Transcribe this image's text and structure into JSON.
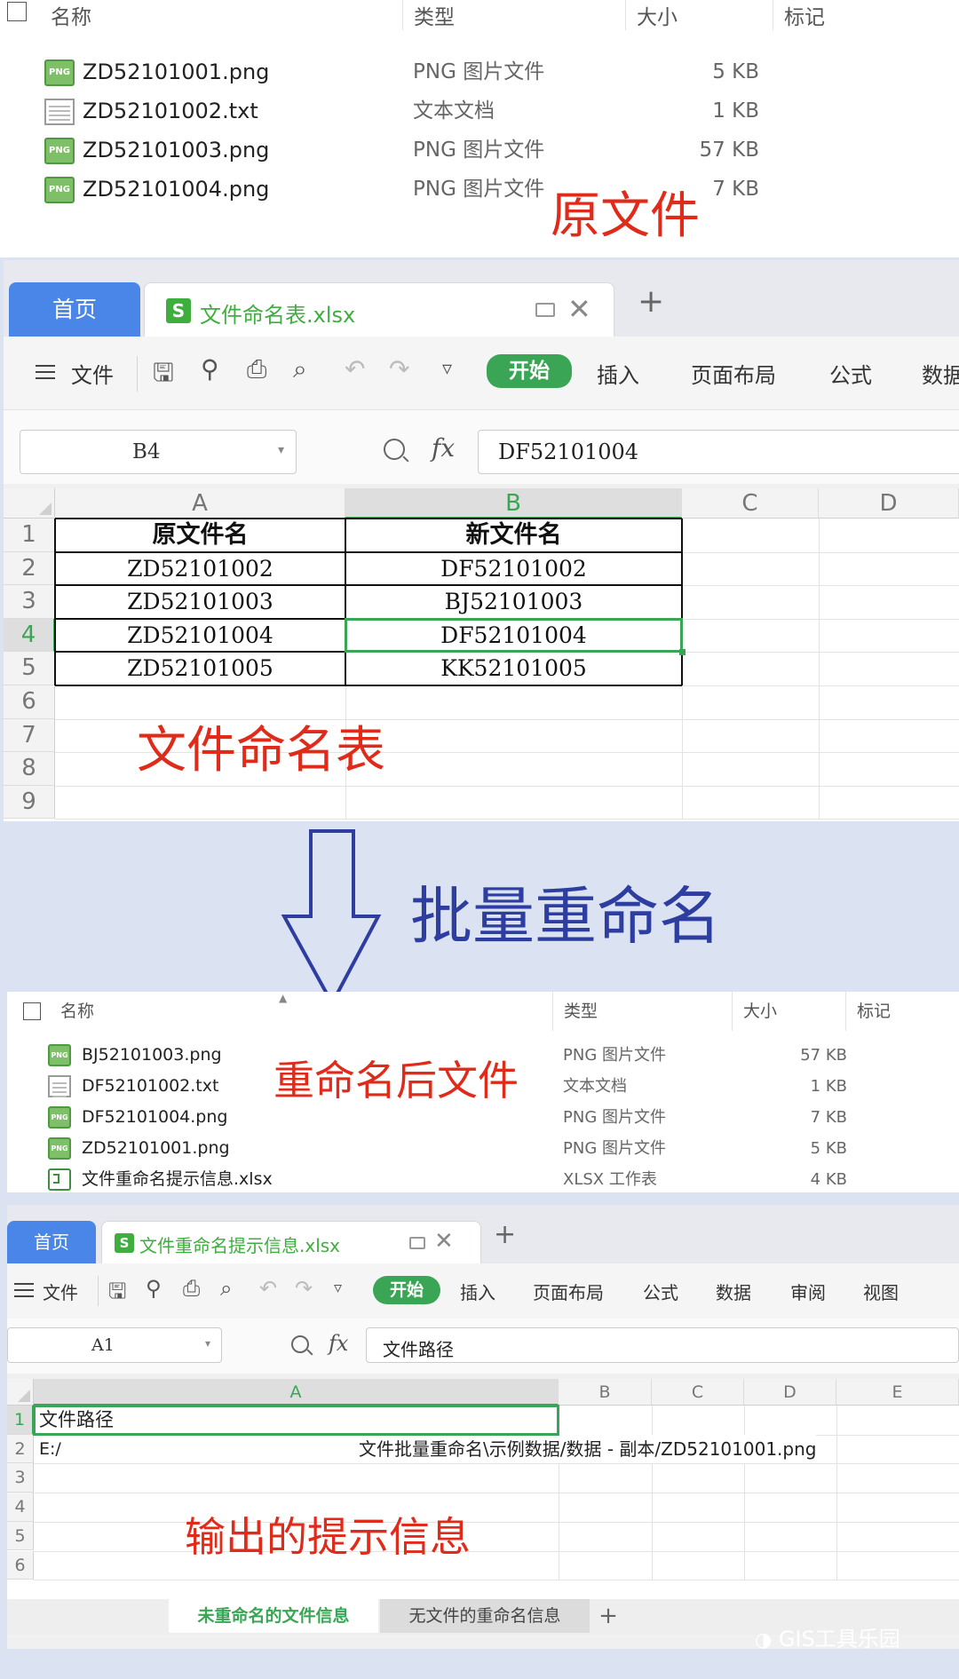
{
  "top_explorer": {
    "columns": [
      "名称",
      "类型",
      "大小",
      "标记"
    ],
    "files": [
      {
        "icon": "png-file-icon",
        "name": "ZD52101001.png",
        "type": "PNG 图片文件",
        "size": "5 KB"
      },
      {
        "icon": "txt-file-icon",
        "name": "ZD52101002.txt",
        "type": "文本文档",
        "size": "1 KB"
      },
      {
        "icon": "png-file-icon",
        "name": "ZD52101003.png",
        "type": "PNG 图片文件",
        "size": "57 KB"
      },
      {
        "icon": "png-file-icon",
        "name": "ZD52101004.png",
        "type": "PNG 图片文件",
        "size": "7 KB"
      }
    ],
    "annotation": "原文件",
    "png_badge": "PNG"
  },
  "wps1": {
    "home_tab": "首页",
    "doc_tab": "文件命名表.xlsx",
    "s_icon": "S",
    "menu_file": "文件",
    "ribbon": [
      "开始",
      "插入",
      "页面布局",
      "公式",
      "数据"
    ],
    "namebox": "B4",
    "fx": "fx",
    "formula": "DF52101004",
    "columns": [
      "A",
      "B",
      "C",
      "D"
    ],
    "rows": [
      "1",
      "2",
      "3",
      "4",
      "5",
      "6",
      "7",
      "8",
      "9"
    ],
    "table_header": [
      "原文件名",
      "新文件名"
    ],
    "table_rows": [
      [
        "ZD52101002",
        "DF52101002"
      ],
      [
        "ZD52101003",
        "BJ52101003"
      ],
      [
        "ZD52101004",
        "DF52101004"
      ],
      [
        "ZD52101005",
        "KK52101005"
      ]
    ],
    "annotation": "文件命名表"
  },
  "middle": {
    "title": "批量重命名"
  },
  "bottom_explorer": {
    "columns": [
      "名称",
      "类型",
      "大小",
      "标记"
    ],
    "files": [
      {
        "icon": "png-file-icon",
        "name": "BJ52101003.png",
        "type": "PNG 图片文件",
        "size": "57 KB"
      },
      {
        "icon": "txt-file-icon",
        "name": "DF52101002.txt",
        "type": "文本文档",
        "size": "1 KB"
      },
      {
        "icon": "png-file-icon",
        "name": "DF52101004.png",
        "type": "PNG 图片文件",
        "size": "7 KB"
      },
      {
        "icon": "png-file-icon",
        "name": "ZD52101001.png",
        "type": "PNG 图片文件",
        "size": "5 KB"
      },
      {
        "icon": "xlsx-file-icon",
        "name": "文件重命名提示信息.xlsx",
        "type": "XLSX 工作表",
        "size": "4 KB"
      }
    ],
    "annotation": "重命名后文件",
    "png_badge": "PNG"
  },
  "wps2": {
    "home_tab": "首页",
    "doc_tab": "文件重命名提示信息.xlsx",
    "s_icon": "S",
    "menu_file": "文件",
    "ribbon": [
      "开始",
      "插入",
      "页面布局",
      "公式",
      "数据",
      "审阅",
      "视图"
    ],
    "namebox": "A1",
    "fx": "fx",
    "formula": "文件路径",
    "columns": [
      "A",
      "B",
      "C",
      "D",
      "E"
    ],
    "rows": [
      "1",
      "2",
      "3",
      "4",
      "5",
      "6"
    ],
    "cell_a1": "文件路径",
    "cell_a2_prefix": "E:/",
    "cell_a2_path": "文件批量重命名\\示例数据/数据 - 副本/ZD52101001.png",
    "annotation": "输出的提示信息",
    "sheet_tabs": [
      "未重命名的文件信息",
      "无文件的重命名信息"
    ],
    "sheet_add": "+"
  },
  "watermark": "GIS工具乐园"
}
